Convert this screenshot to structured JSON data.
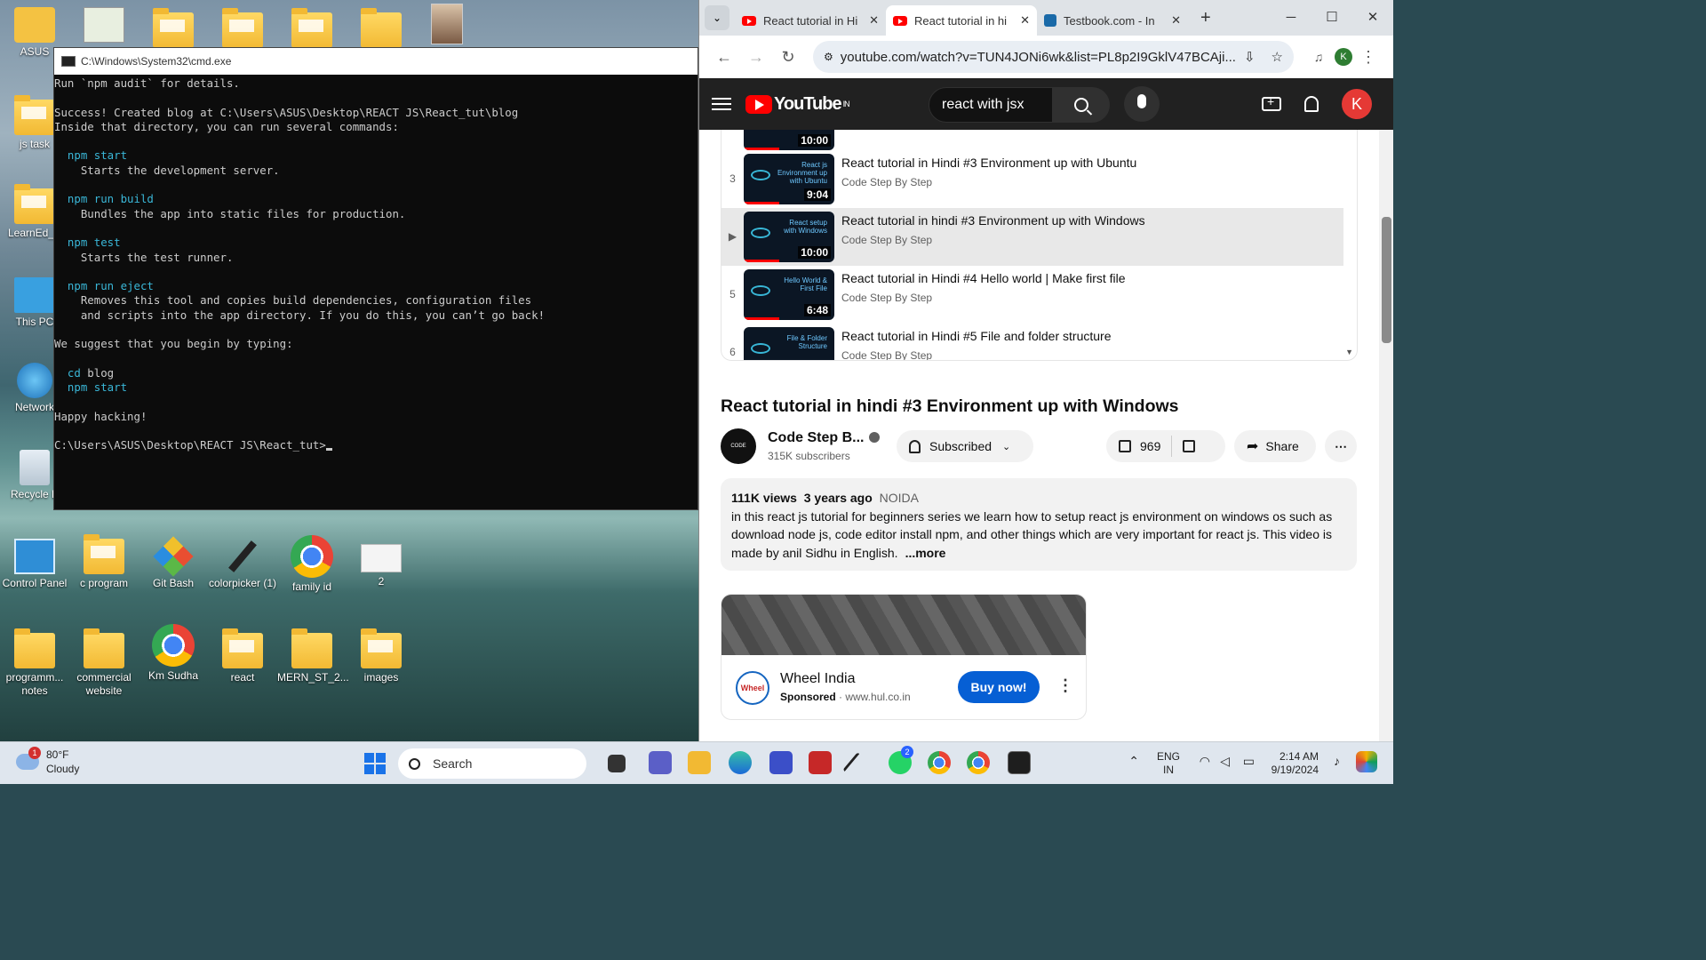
{
  "desktop": {
    "top_icons": [
      {
        "label": "ASUS"
      },
      {
        "label": ""
      },
      {
        "label": ""
      },
      {
        "label": ""
      },
      {
        "label": ""
      },
      {
        "label": ""
      },
      {
        "label": ""
      }
    ],
    "left_icons": [
      "js task",
      "LearnEd_B",
      "This PC",
      "Network",
      "Recycle B"
    ],
    "row1": [
      "Control Panel",
      "c program",
      "Git Bash",
      "colorpicker (1)",
      "family id",
      "2"
    ],
    "row2": [
      "programm... notes",
      "commercial website",
      "Km Sudha",
      "react",
      "MERN_ST_2...",
      "images"
    ]
  },
  "cmd": {
    "title": "C:\\Windows\\System32\\cmd.exe",
    "lines": [
      {
        "text": "Run `npm audit` for details.",
        "cls": ""
      },
      {
        "text": "",
        "cls": ""
      },
      {
        "text": "Success! Created blog at C:\\Users\\ASUS\\Desktop\\REACT JS\\React_tut\\blog",
        "cls": ""
      },
      {
        "text": "Inside that directory, you can run several commands:",
        "cls": ""
      },
      {
        "text": "",
        "cls": ""
      },
      {
        "text": "  npm start",
        "cls": "cy"
      },
      {
        "text": "    Starts the development server.",
        "cls": ""
      },
      {
        "text": "",
        "cls": ""
      },
      {
        "text": "  npm run build",
        "cls": "cy"
      },
      {
        "text": "    Bundles the app into static files for production.",
        "cls": ""
      },
      {
        "text": "",
        "cls": ""
      },
      {
        "text": "  npm test",
        "cls": "cy"
      },
      {
        "text": "    Starts the test runner.",
        "cls": ""
      },
      {
        "text": "",
        "cls": ""
      },
      {
        "text": "  npm run eject",
        "cls": "cy"
      },
      {
        "text": "    Removes this tool and copies build dependencies, configuration files",
        "cls": ""
      },
      {
        "text": "    and scripts into the app directory. If you do this, you can’t go back!",
        "cls": ""
      },
      {
        "text": "",
        "cls": ""
      },
      {
        "text": "We suggest that you begin by typing:",
        "cls": ""
      },
      {
        "text": "",
        "cls": ""
      },
      {
        "text": "  cd blog",
        "cls": "cy-first"
      },
      {
        "text": "  npm start",
        "cls": "cy"
      },
      {
        "text": "",
        "cls": ""
      },
      {
        "text": "Happy hacking!",
        "cls": ""
      },
      {
        "text": "",
        "cls": ""
      }
    ],
    "prompt": "C:\\Users\\ASUS\\Desktop\\REACT JS\\React_tut>"
  },
  "browser": {
    "tabs": [
      {
        "title": "React tutorial in Hi",
        "icon": "youtube-icon",
        "active": false
      },
      {
        "title": "React tutorial in hi",
        "icon": "youtube-icon",
        "active": true
      },
      {
        "title": "Testbook.com - In",
        "icon": "testbook-icon",
        "active": false
      }
    ],
    "url": "youtube.com/watch?v=TUN4JONi6wk&list=PL8p2I9GklV47BCAji...",
    "profile_initial": "K"
  },
  "youtube": {
    "logo_text": "YouTube",
    "region": "IN",
    "search_value": "react with jsx",
    "avatar_initial": "K",
    "playlist": [
      {
        "index": "",
        "title": "",
        "channel": "Code Step By Step",
        "duration": "10:00",
        "caption": ""
      },
      {
        "index": "3",
        "title": "React tutorial in Hindi #3 Environment up with Ubuntu",
        "channel": "Code Step By Step",
        "duration": "9:04",
        "caption": "React js Environment up with Ubuntu"
      },
      {
        "index": "▶",
        "title": "React tutorial in hindi #3 Environment up with Windows",
        "channel": "Code Step By Step",
        "duration": "10:00",
        "caption": "React setup with Windows",
        "active": true
      },
      {
        "index": "5",
        "title": "React tutorial in Hindi #4 Hello world | Make first file",
        "channel": "Code Step By Step",
        "duration": "6:48",
        "caption": "Hello World & First File"
      },
      {
        "index": "6",
        "title": "React tutorial in Hindi #5 File and folder structure",
        "channel": "Code Step By Step",
        "duration": "",
        "caption": "File & Folder Structure"
      }
    ],
    "video_title": "React tutorial in hindi #3 Environment up with Windows",
    "channel_name": "Code Step B...",
    "subscribers": "315K subscribers",
    "subscribed_label": "Subscribed",
    "likes": "969",
    "share_label": "Share",
    "views": "111K views",
    "age": "3 years ago",
    "location": "NOIDA",
    "description": "in this react js tutorial for beginners series we learn how to setup react js environment on windows os such as download node js, code editor install npm, and other things which are very important for react js. This video is made by anil Sidhu in English.",
    "more_label": "...more",
    "ad": {
      "advertiser": "Wheel India",
      "sponsored": "Sponsored",
      "domain": "www.hul.co.in",
      "cta": "Buy now!",
      "logo_text": "Wheel"
    }
  },
  "taskbar": {
    "temp": "80°F",
    "condition": "Cloudy",
    "weather_badge": "1",
    "search_label": "Search",
    "whatsapp_badge": "2",
    "lang": "ENG",
    "region": "IN",
    "time": "2:14 AM",
    "date": "9/19/2024"
  },
  "colors": {
    "youtube_red": "#ff0000",
    "cta_blue": "#065fd4",
    "terminal_cyan": "#3ab7d8"
  }
}
